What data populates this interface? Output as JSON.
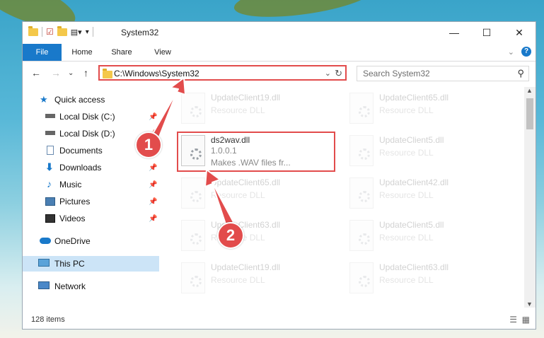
{
  "window": {
    "title": "System32"
  },
  "ribbon": {
    "tabs": [
      "File",
      "Home",
      "Share",
      "View"
    ]
  },
  "address": {
    "path": "C:\\Windows\\System32",
    "search_placeholder": "Search System32"
  },
  "sidebar": {
    "items": [
      {
        "label": "Quick access",
        "icon": "star-icon",
        "pinned": false
      },
      {
        "label": "Local Disk (C:)",
        "icon": "drive-icon",
        "pinned": true
      },
      {
        "label": "Local Disk (D:)",
        "icon": "drive-icon",
        "pinned": true
      },
      {
        "label": "Documents",
        "icon": "documents-icon",
        "pinned": true
      },
      {
        "label": "Downloads",
        "icon": "download-icon",
        "pinned": true
      },
      {
        "label": "Music",
        "icon": "music-icon",
        "pinned": true
      },
      {
        "label": "Pictures",
        "icon": "pictures-icon",
        "pinned": true
      },
      {
        "label": "Videos",
        "icon": "videos-icon",
        "pinned": true
      },
      {
        "label": "OneDrive",
        "icon": "cloud-icon",
        "pinned": false
      },
      {
        "label": "This PC",
        "icon": "computer-icon",
        "pinned": false
      },
      {
        "label": "Network",
        "icon": "network-icon",
        "pinned": false
      }
    ]
  },
  "files": [
    {
      "name": "UpdateClient19.dll",
      "desc": "Resource DLL",
      "faded": true
    },
    {
      "name": "UpdateClient65.dll",
      "desc": "Resource DLL",
      "faded": true
    },
    {
      "name": "ds2wav.dll",
      "desc": "1.0.0.1",
      "desc2": "Makes .WAV files fr...",
      "faded": false
    },
    {
      "name": "UpdateClient5.dll",
      "desc": "Resource DLL",
      "faded": true
    },
    {
      "name": "UpdateClient65.dll",
      "desc": "Resource DLL",
      "faded": true
    },
    {
      "name": "UpdateClient42.dll",
      "desc": "Resource DLL",
      "faded": true
    },
    {
      "name": "UpdateClient63.dll",
      "desc": "Resource DLL",
      "faded": true
    },
    {
      "name": "UpdateClient5.dll",
      "desc": "Resource DLL",
      "faded": true
    },
    {
      "name": "UpdateClient19.dll",
      "desc": "Resource DLL",
      "faded": true
    },
    {
      "name": "UpdateClient63.dll",
      "desc": "Resource DLL",
      "faded": true
    }
  ],
  "status": {
    "count": "128 items"
  },
  "annotations": {
    "step1": "1",
    "step2": "2"
  },
  "colors": {
    "accent": "#1979ca",
    "annotation": "#e24c4c"
  }
}
